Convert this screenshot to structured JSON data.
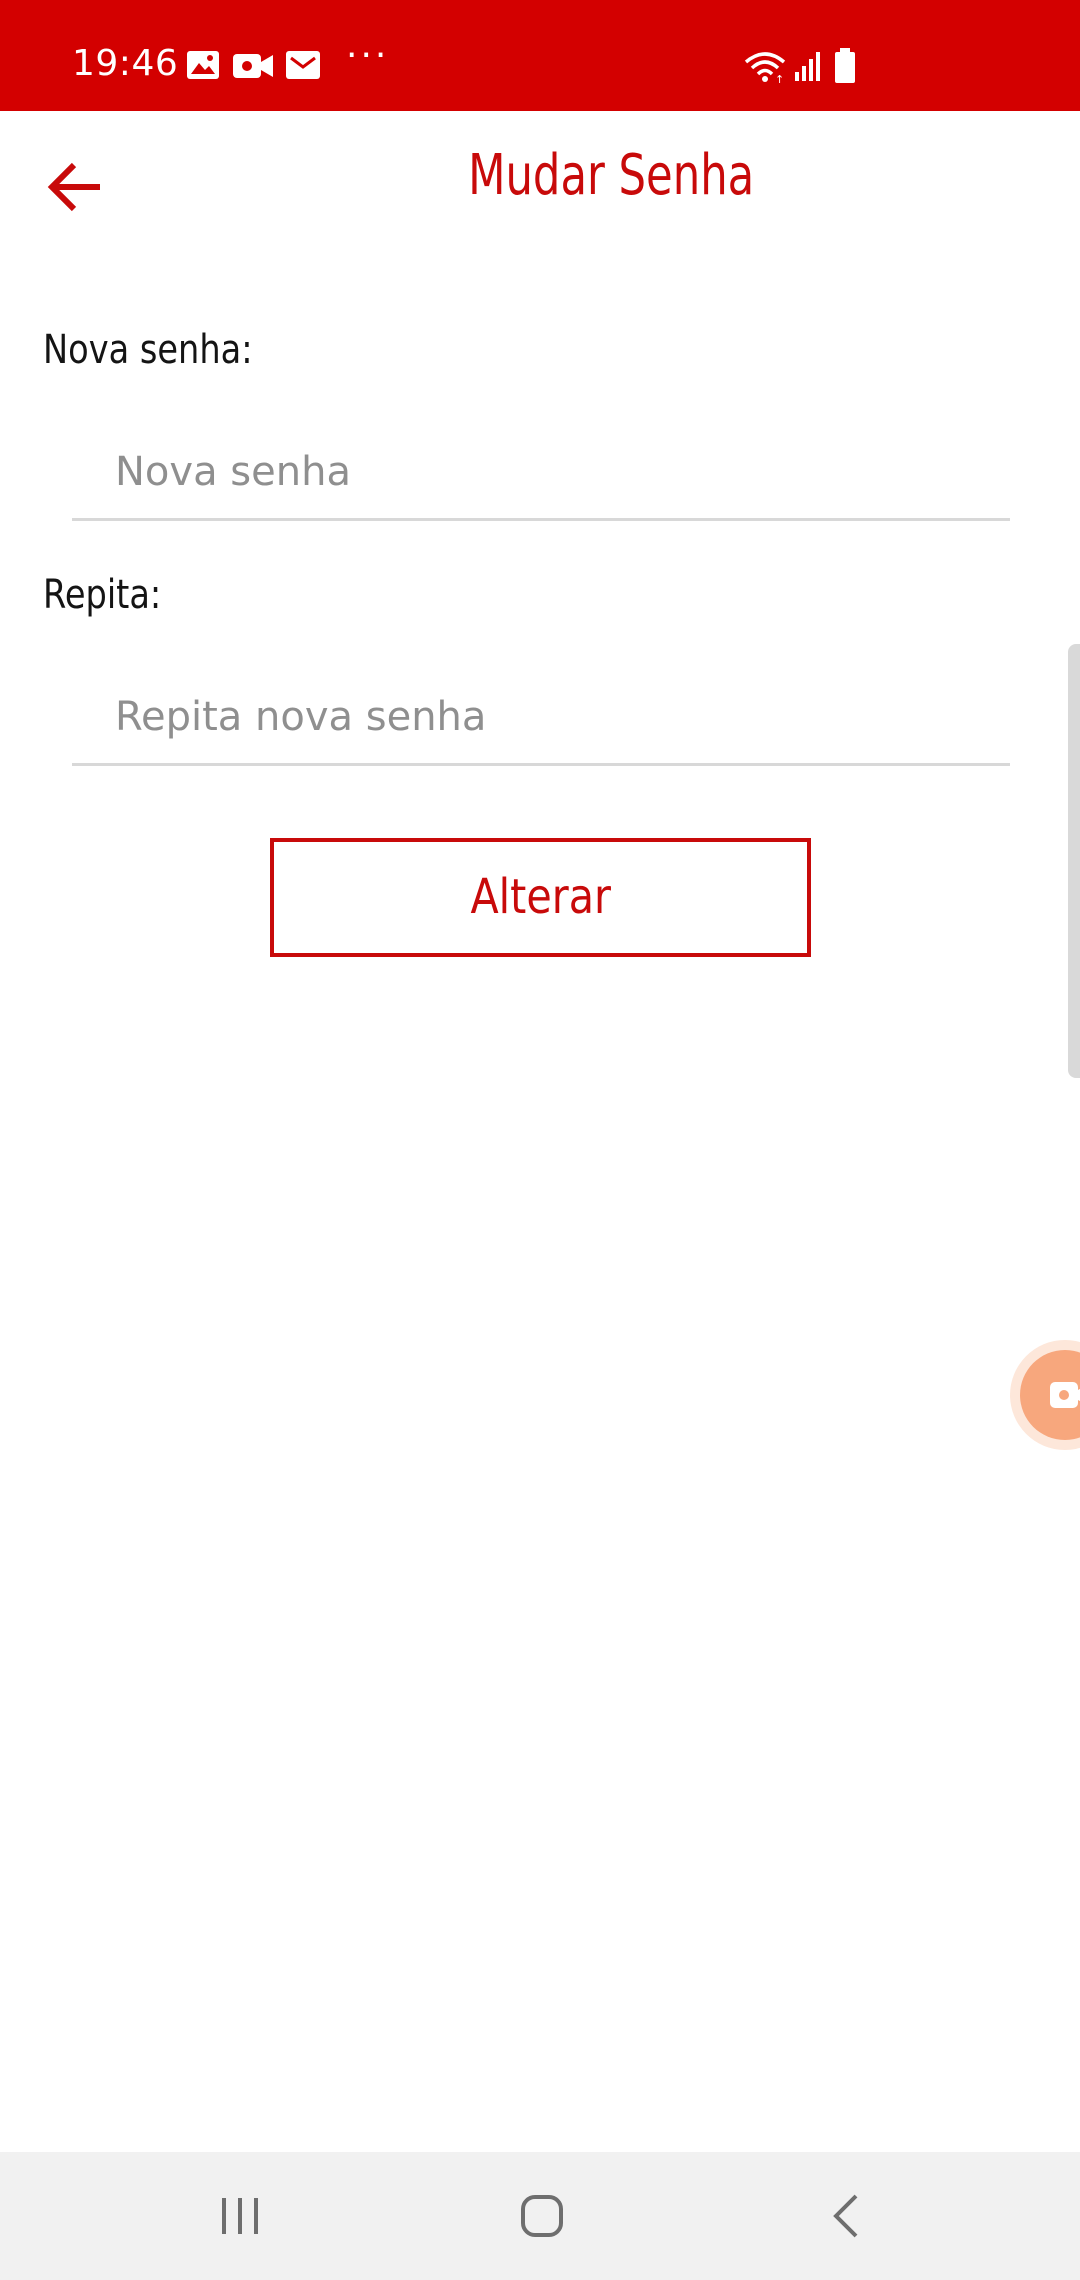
{
  "status_bar": {
    "time": "19:46",
    "background": "#d30000",
    "icons": [
      "image-icon",
      "video-camera-icon",
      "mail-icon",
      "more-dots-icon",
      "wifi-icon",
      "signal-icon",
      "battery-icon"
    ],
    "dots": "···"
  },
  "header": {
    "title": "Mudar Senha",
    "back_icon": "arrow-left-icon",
    "accent": "#c80a0a"
  },
  "form": {
    "new_password_label": "Nova senha:",
    "new_password_placeholder": "Nova senha",
    "new_password_value": "",
    "repeat_label": "Repita:",
    "repeat_placeholder": "Repita nova senha",
    "repeat_value": "",
    "submit_label": "Alterar"
  },
  "floating_bubble": {
    "icon": "video-camera-icon",
    "color": "#f7a77d"
  },
  "nav_bar": {
    "buttons": [
      "recents-icon",
      "home-icon",
      "back-chevron-icon"
    ]
  }
}
